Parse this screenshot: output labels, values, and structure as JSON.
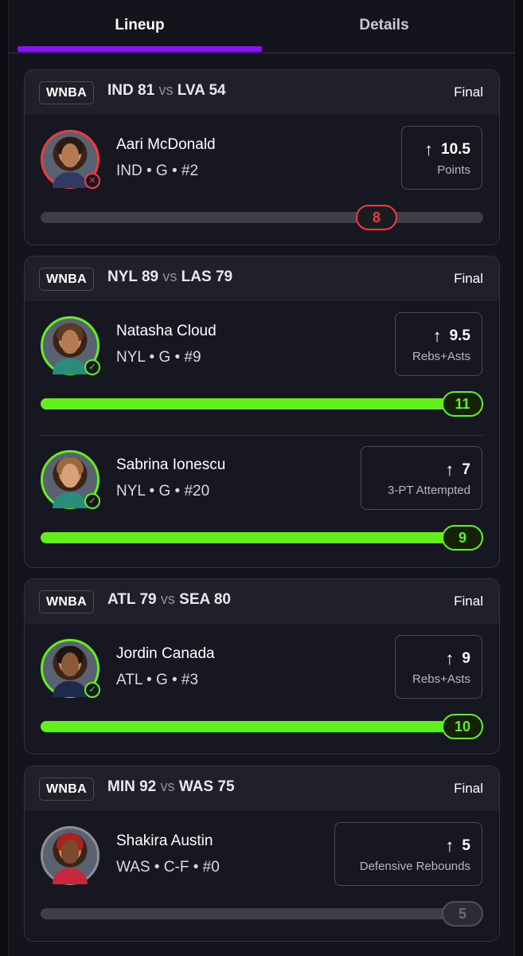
{
  "tabs": {
    "lineup": "Lineup",
    "details": "Details"
  },
  "games": [
    {
      "league": "WNBA",
      "team1": "IND",
      "score1": "81",
      "vs": "vs",
      "team2": "LVA",
      "score2": "54",
      "status": "Final",
      "players": [
        {
          "name": "Aari McDonald",
          "meta": "IND • G • #2",
          "line": "10.5",
          "stat": "Points",
          "actual": "8",
          "result": "miss",
          "progress": 0.76
        }
      ]
    },
    {
      "league": "WNBA",
      "team1": "NYL",
      "score1": "89",
      "vs": "vs",
      "team2": "LAS",
      "score2": "79",
      "status": "Final",
      "players": [
        {
          "name": "Natasha Cloud",
          "meta": "NYL • G • #9",
          "line": "9.5",
          "stat": "Rebs+Asts",
          "actual": "11",
          "result": "hit",
          "progress": 1.0
        },
        {
          "name": "Sabrina Ionescu",
          "meta": "NYL • G • #20",
          "line": "7",
          "stat": "3-PT Attempted",
          "actual": "9",
          "result": "hit",
          "progress": 1.0
        }
      ]
    },
    {
      "league": "WNBA",
      "team1": "ATL",
      "score1": "79",
      "vs": "vs",
      "team2": "SEA",
      "score2": "80",
      "status": "Final",
      "players": [
        {
          "name": "Jordin Canada",
          "meta": "ATL • G • #3",
          "line": "9",
          "stat": "Rebs+Asts",
          "actual": "10",
          "result": "hit",
          "progress": 1.0
        }
      ]
    },
    {
      "league": "WNBA",
      "team1": "MIN",
      "score1": "92",
      "vs": "vs",
      "team2": "WAS",
      "score2": "75",
      "status": "Final",
      "players": [
        {
          "name": "Shakira Austin",
          "meta": "WAS • C-F • #0",
          "line": "5",
          "stat": "Defensive Rebounds",
          "actual": "5",
          "result": "push",
          "progress": 1.0
        }
      ]
    }
  ],
  "icons": {
    "arrow": "arrow-up-icon",
    "miss": "x-circle-icon",
    "hit": "check-circle-icon"
  },
  "colors": {
    "accent": "#8a12f5",
    "hit": "#62f01c",
    "miss": "#ef3b3b",
    "neutral": "#6c6d76"
  }
}
